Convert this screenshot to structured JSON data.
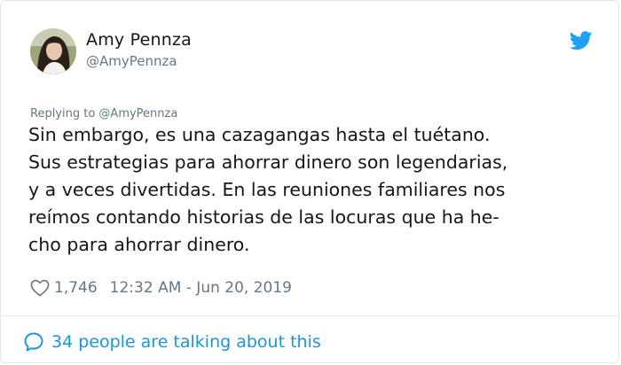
{
  "tweet": {
    "author_name": "Amy Pennza",
    "author_handle": "@AmyPennza",
    "replying_to": "Replying to @AmyPennza",
    "body_lines": [
      "Sin embargo, es una cazagangas hasta el tuétano.",
      "Sus estrategias para ahorrar dinero son legendarias,",
      "y a veces divertidas. En las reuniones familiares nos",
      "reímos contando historias de las locuras que ha he-",
      "cho para ahorrar dinero."
    ],
    "like_count": "1,746",
    "timestamp": "12:32 AM - Jun 20, 2019",
    "conversation_link": "34 people are talking about this"
  },
  "icons": {
    "brand": "twitter-bird-icon",
    "like": "heart-outline-icon",
    "reply": "speech-bubble-icon"
  },
  "colors": {
    "brand_blue": "#1da1f2",
    "link_blue": "#1b95e0",
    "secondary_text": "#657786",
    "primary_text": "#14171a",
    "border": "#e1e8ed"
  }
}
